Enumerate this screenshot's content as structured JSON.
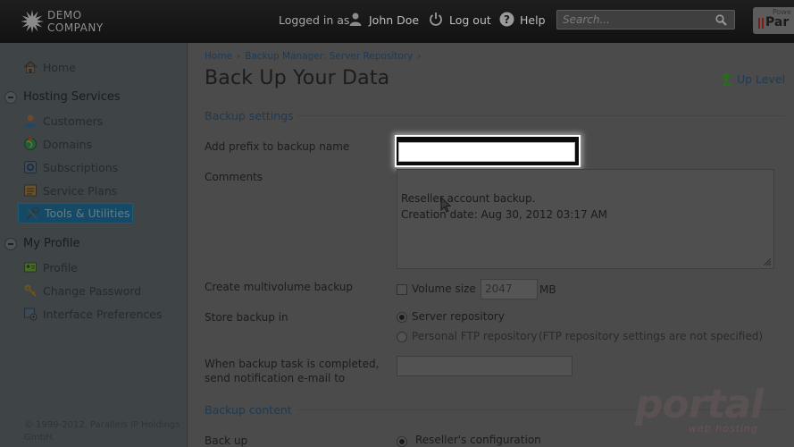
{
  "header": {
    "logo_line1": "DEMO",
    "logo_line2": "COMPANY",
    "logged_in_label": "Logged in as",
    "user_name": "John Doe",
    "logout_label": "Log out",
    "help_label": "Help",
    "search_placeholder": "Search...",
    "brand_powered": "Powe",
    "brand_name": "Par"
  },
  "sidebar": {
    "home": "Home",
    "hosting_services": "Hosting Services",
    "customers": "Customers",
    "domains": "Domains",
    "subscriptions": "Subscriptions",
    "service_plans": "Service Plans",
    "tools_utilities": "Tools & Utilities",
    "my_profile": "My Profile",
    "profile": "Profile",
    "change_password": "Change Password",
    "interface_preferences": "Interface Preferences",
    "copyright": "© 1999-2012. Parallels IP Holdings GmbH."
  },
  "breadcrumb": {
    "home": "Home",
    "backup_manager": "Backup Manager: Server Repository"
  },
  "page": {
    "title": "Back Up Your Data",
    "up_level": "Up Level"
  },
  "backup_settings": {
    "section_title": "Backup settings",
    "prefix_label": "Add prefix to backup name",
    "prefix_value": "",
    "comments_label": "Comments",
    "comments_value": "Reseller account  backup.\nCreation date: Aug 30, 2012 03:17 AM",
    "multivolume_label": "Create multivolume backup",
    "volume_size_label": "Volume size",
    "volume_size_value": "2047",
    "volume_unit": "MB",
    "store_label": "Store backup in",
    "server_repo_label": "Server repository",
    "ftp_repo_label": "Personal FTP repository",
    "ftp_repo_note": "(FTP repository settings are not specified)",
    "email_label_line1": "When backup task is completed,",
    "email_label_line2": "send notification e-mail to",
    "email_value": ""
  },
  "backup_content": {
    "section_title": "Backup content",
    "back_up_label": "Back up",
    "resellers_config": "Reseller's configuration"
  },
  "watermark": {
    "text": "portal",
    "sub": "web hosting"
  }
}
